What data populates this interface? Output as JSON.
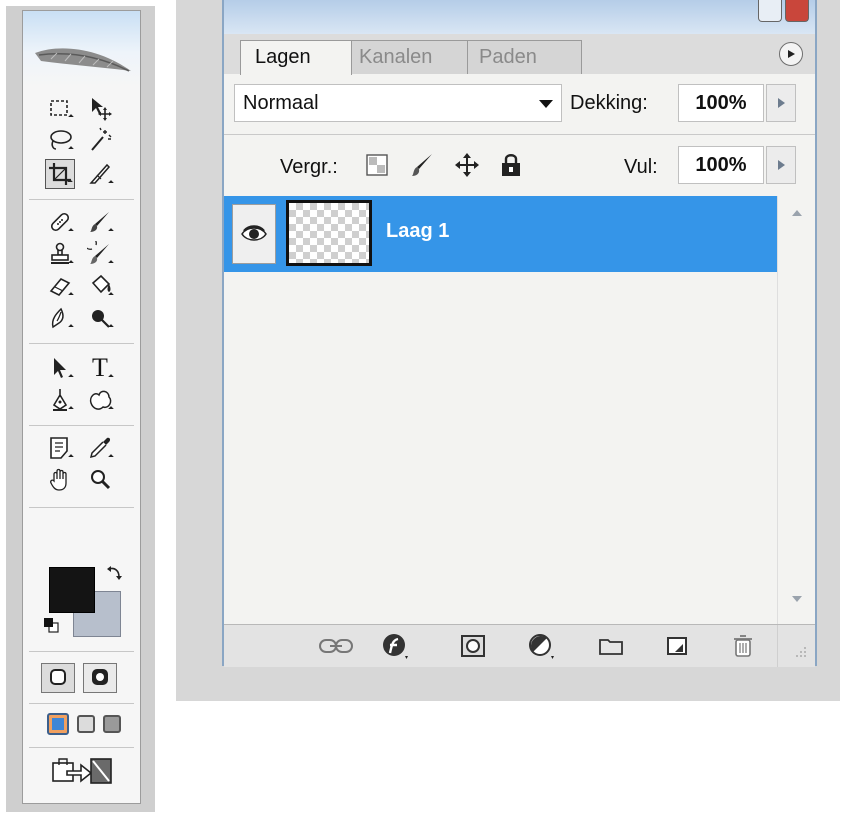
{
  "toolbox": {
    "type_tool_label": "T",
    "tools": [
      "rectangular-marquee",
      "move",
      "lasso",
      "magic-wand",
      "crop",
      "slice",
      "healing-brush",
      "brush",
      "clone-stamp",
      "history-brush",
      "eraser",
      "paint-bucket",
      "blur",
      "dodge",
      "path-selection",
      "type",
      "pen",
      "custom-shape",
      "notes",
      "eyedropper",
      "hand",
      "zoom"
    ],
    "foreground_color": "#141414",
    "background_color": "#b7bfcc"
  },
  "layers_panel": {
    "tabs": [
      {
        "label": "Lagen",
        "active": true
      },
      {
        "label": "Kanalen",
        "active": false
      },
      {
        "label": "Paden",
        "active": false
      }
    ],
    "blend_mode": "Normaal",
    "opacity_label": "Dekking:",
    "opacity_value": "100%",
    "lock_label": "Vergr.:",
    "fill_label": "Vul:",
    "fill_value": "100%",
    "layers": [
      {
        "name": "Laag 1",
        "visible": true,
        "selected": true
      }
    ],
    "footer_buttons": [
      "link-layers",
      "layer-style",
      "layer-mask",
      "adjustment-layer",
      "new-group",
      "new-layer",
      "delete-layer"
    ],
    "selection_color": "#3595e8"
  }
}
